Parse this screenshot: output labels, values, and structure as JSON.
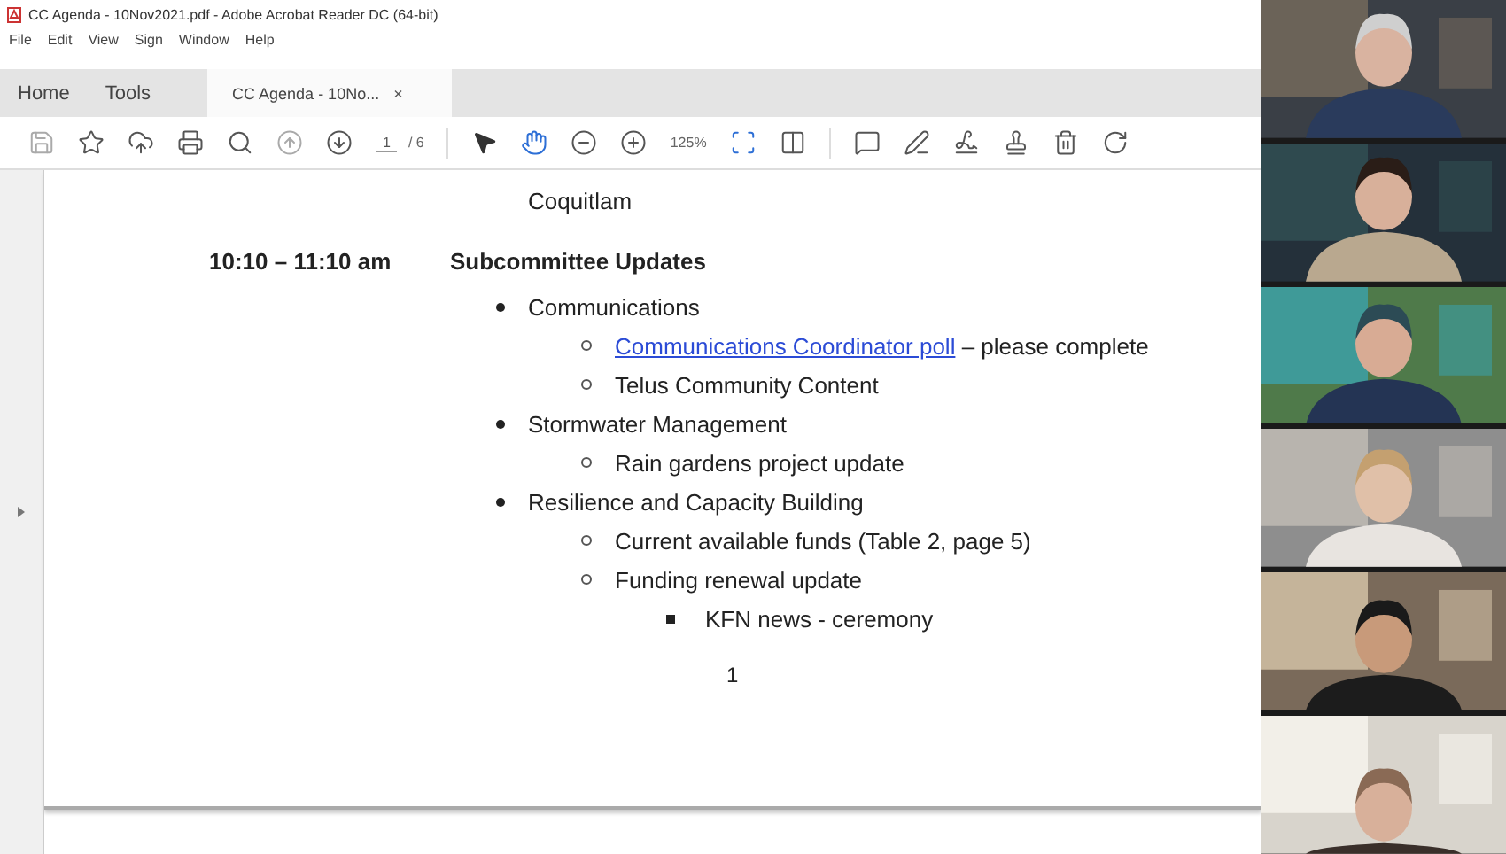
{
  "window": {
    "title": "CC Agenda - 10Nov2021.pdf - Adobe Acrobat Reader DC (64-bit)"
  },
  "menu": [
    "File",
    "Edit",
    "View",
    "Sign",
    "Window",
    "Help"
  ],
  "tabs": [
    {
      "label": "Home",
      "selected": false
    },
    {
      "label": "Tools",
      "selected": false
    },
    {
      "label": "CC Agenda - 10No...",
      "selected": true,
      "close": "×"
    }
  ],
  "toolbar": {
    "page": "1",
    "page_total": "/ 6",
    "zoom": "125%"
  },
  "document": {
    "lead_line": "Coquitlam",
    "agenda": [
      {
        "time": "10:10 – 11:10 am",
        "heading": "Subcommittee Updates",
        "items": [
          {
            "text": "Communications",
            "children": [
              {
                "link": "Communications Coordinator poll",
                "text": " – please complete"
              },
              {
                "text": "Telus Community Content"
              }
            ]
          },
          {
            "text": "Stormwater Management",
            "children": [
              {
                "text": "Rain gardens project update"
              }
            ]
          },
          {
            "text": "Resilience and Capacity Building",
            "children": [
              {
                "text": "Current available funds (Table 2, page 5)"
              },
              {
                "text": "Funding renewal update",
                "children": [
                  {
                    "text": "KFN news - ceremony"
                  }
                ]
              }
            ]
          }
        ]
      }
    ],
    "page_number": "1"
  }
}
